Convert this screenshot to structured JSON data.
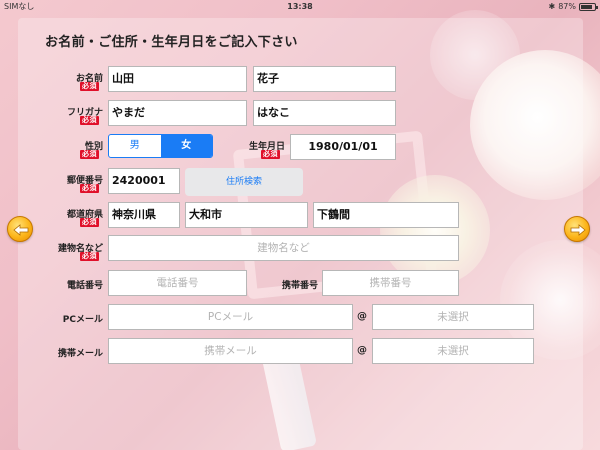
{
  "status": {
    "carrier": "SIMなし",
    "time": "13:38",
    "bluetooth": "✱",
    "battery": "87%"
  },
  "title": "お名前・ご住所・生年月日をご記入下さい",
  "required_badge": "必須",
  "labels": {
    "name": "お名前",
    "kana": "フリガナ",
    "gender": "性別",
    "birthday": "生年月日",
    "postal": "郵便番号",
    "prefecture": "都道府県",
    "building": "建物名など",
    "phone": "電話番号",
    "mobile": "携帯番号",
    "pc_mail": "PCメール",
    "mobile_mail": "携帯メール"
  },
  "fields": {
    "last_name": "山田",
    "first_name": "花子",
    "last_kana": "やまだ",
    "first_kana": "はなこ",
    "birthday": "1980/01/01",
    "postal": "2420001",
    "prefecture": "神奈川県",
    "city": "大和市",
    "town": "下鶴間"
  },
  "placeholders": {
    "building": "建物名など",
    "phone": "電話番号",
    "mobile": "携帯番号",
    "pc_mail": "PCメール",
    "pc_mail_domain": "未選択",
    "mobile_mail": "携帯メール",
    "mobile_mail_domain": "未選択"
  },
  "gender": {
    "male": "男",
    "female": "女",
    "selected": "女"
  },
  "address_search_label": "住所検索",
  "at_sign": "@",
  "colors": {
    "accent": "#1a7cf5",
    "required": "#e0102a",
    "nav": "#fcb51a"
  },
  "icons": {
    "prev": "arrow-left-icon",
    "next": "arrow-right-icon"
  }
}
